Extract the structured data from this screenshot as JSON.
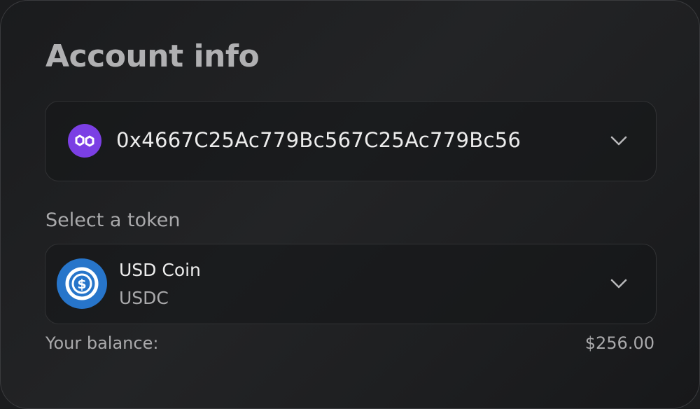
{
  "card": {
    "title": "Account info"
  },
  "account": {
    "network_icon": "polygon-icon",
    "network_color": "#7b3fe4",
    "address": "0x4667C25Ac779Bc567C25Ac779Bc56",
    "dropdown_icon": "chevron-down-icon"
  },
  "token_section": {
    "label": "Select a token",
    "selected": {
      "icon": "usdc-icon",
      "icon_color": "#2775ca",
      "name": "USD Coin",
      "symbol": "USDC"
    },
    "dropdown_icon": "chevron-down-icon"
  },
  "balance": {
    "label": "Your balance:",
    "value": "$256.00"
  }
}
